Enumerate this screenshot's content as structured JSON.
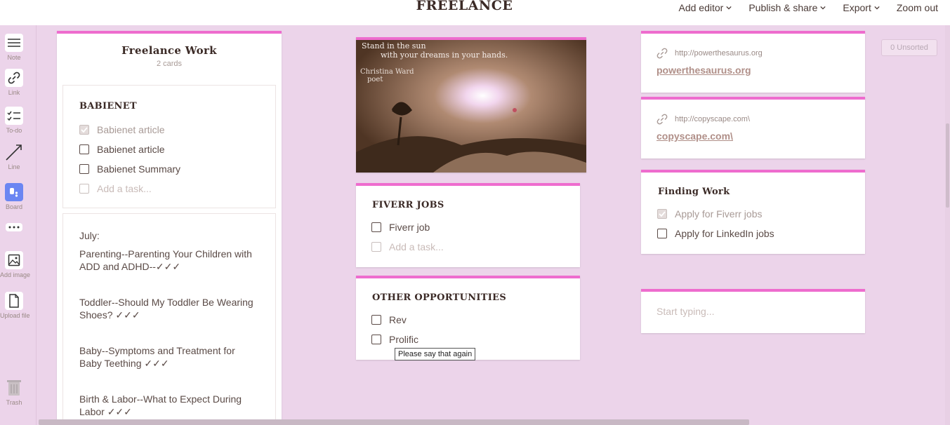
{
  "header": {
    "title": "FREELANCE",
    "menu": [
      {
        "label": "Add editor",
        "has_chevron": true
      },
      {
        "label": "Publish & share",
        "has_chevron": true
      },
      {
        "label": "Export",
        "has_chevron": true
      },
      {
        "label": "Zoom out",
        "has_chevron": false
      }
    ]
  },
  "sidebar": {
    "tools": [
      {
        "label": "Note",
        "icon": "note-icon"
      },
      {
        "label": "Link",
        "icon": "link-icon"
      },
      {
        "label": "To-do",
        "icon": "todo-icon"
      },
      {
        "label": "Line",
        "icon": "line-icon"
      },
      {
        "label": "Board",
        "icon": "board-icon"
      },
      {
        "label": "",
        "icon": "more-icon"
      },
      {
        "label": "Add image",
        "icon": "image-icon"
      },
      {
        "label": "Upload file",
        "icon": "file-icon"
      }
    ],
    "trash_label": "Trash"
  },
  "column_board": {
    "title": "Freelance Work",
    "subtitle": "2 cards",
    "todo": {
      "title": "BABIENET",
      "tasks": [
        {
          "text": "Babienet article",
          "done": true
        },
        {
          "text": "Babienet article",
          "done": false
        },
        {
          "text": "Babienet Summary",
          "done": false
        }
      ],
      "add_placeholder": "Add a task..."
    },
    "note": {
      "lines": [
        "July:",
        "Parenting--Parenting Your Children with ADD and ADHD--✓✓✓",
        "Toddler--Should My Toddler Be Wearing Shoes? ✓✓✓",
        "Baby--Symptoms and Treatment for Baby Teething ✓✓✓",
        "Birth & Labor--What to Expect During Labor ✓✓✓"
      ]
    }
  },
  "image_card": {
    "quote_line1": "Stand in the sun",
    "quote_line2": "with your dreams in your hands.",
    "author": "Christina Ward",
    "author_role": "poet"
  },
  "fiverr": {
    "title": "FIVERR JOBS",
    "tasks": [
      {
        "text": "Fiverr job",
        "done": false
      }
    ],
    "add_placeholder": "Add a task..."
  },
  "other": {
    "title": "OTHER OPPORTUNITIES",
    "tasks": [
      {
        "text": "Rev",
        "done": false
      },
      {
        "text": "Prolific",
        "done": false
      }
    ]
  },
  "links": [
    {
      "url": "http://powerthesaurus.org",
      "title": "powerthesaurus.org"
    },
    {
      "url": "http://copyscape.com\\",
      "title": "copyscape.com\\"
    }
  ],
  "finding": {
    "title": "Finding Work",
    "tasks": [
      {
        "text": "Apply for Fiverr jobs",
        "done": true
      },
      {
        "text": "Apply for LinkedIn jobs",
        "done": false
      }
    ]
  },
  "empty_note": {
    "placeholder": "Start typing..."
  },
  "unsorted_label": "0 Unsorted",
  "tooltip": "Please say that again",
  "colors": {
    "accent": "#ee6cce",
    "background": "#ecd4ea",
    "board_icon": "#6b86f2"
  }
}
